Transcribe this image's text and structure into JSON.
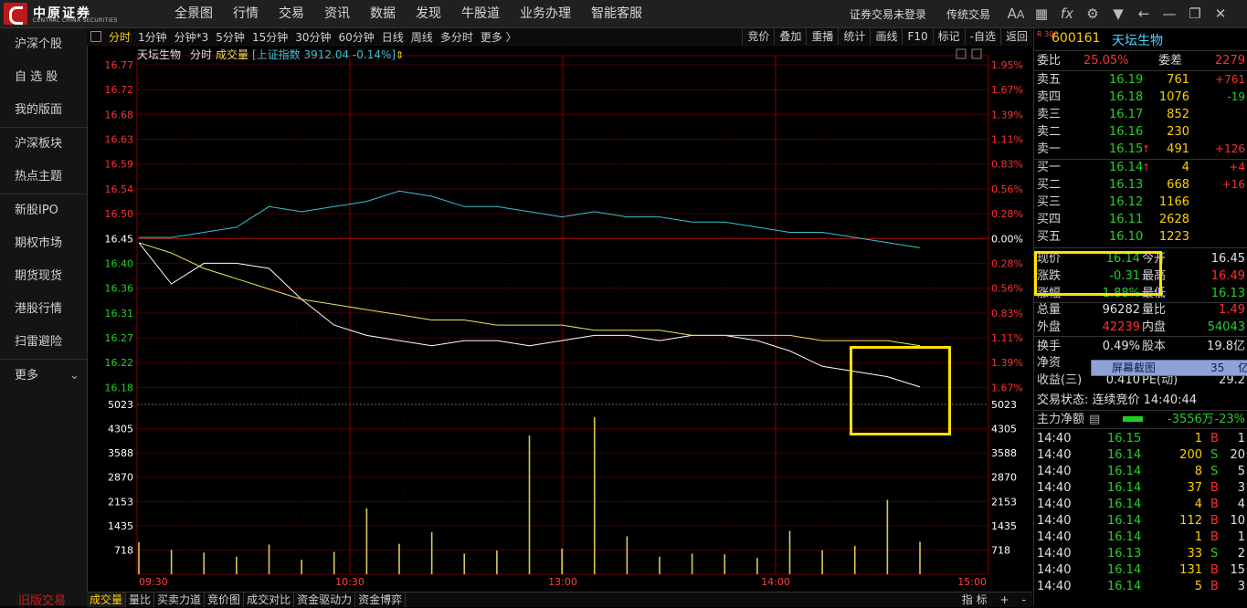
{
  "topbar": {
    "logo_cn": "中原证券",
    "logo_en": "CENTRAL CHINA SECURITIES",
    "menu": [
      "全景图",
      "行情",
      "交易",
      "资讯",
      "数据",
      "发现",
      "牛股道",
      "业务办理",
      "智能客服"
    ],
    "login": "证券交易未登录",
    "traditional": "传统交易",
    "icons": [
      "font-size-icon",
      "grid-icon",
      "fx-icon",
      "gear-icon",
      "shirt-icon",
      "back-arrow-icon",
      "minimize-icon",
      "restore-icon",
      "close-icon"
    ]
  },
  "sidebar": {
    "items": [
      "沪深个股",
      "自 选 股",
      "我的版面",
      "沪深板块",
      "热点主题",
      "新股IPO",
      "期权市场",
      "期货现货",
      "港股行情",
      "扫雷避险",
      "更多"
    ],
    "bottom_text": "旧版交易"
  },
  "toolbar": {
    "periods": [
      "分时",
      "1分钟",
      "分钟*3",
      "5分钟",
      "15分钟",
      "30分钟",
      "60分钟",
      "日线",
      "周线",
      "多分时",
      "更多 〉"
    ],
    "right_tools": [
      "竞价",
      "叠加",
      "重播",
      "统计",
      "画线",
      "F10",
      "标记",
      "-自选",
      "返回"
    ]
  },
  "chart_header": {
    "name": "天坛生物",
    "mode": "分时",
    "vol_label": "成交量",
    "index_text": "[上证指数 3912.04 -0.14%]",
    "arrow_icon": "up-down-arrow-icon"
  },
  "chart_data": {
    "type": "line",
    "time_ticks": [
      "09:30",
      "10:30",
      "13:00",
      "14:00",
      "15:00"
    ],
    "price_ticks": [
      "16.77",
      "16.72",
      "16.68",
      "16.63",
      "16.59",
      "16.54",
      "16.50",
      "16.45",
      "16.40",
      "16.36",
      "16.31",
      "16.27",
      "16.22",
      "16.18"
    ],
    "pct_ticks": [
      "1.95%",
      "1.67%",
      "1.39%",
      "1.11%",
      "0.83%",
      "0.56%",
      "0.28%",
      "0.00%",
      "0.28%",
      "0.56%",
      "0.83%",
      "1.11%",
      "1.39%",
      "1.67%"
    ],
    "prev_close": 16.45,
    "ylim": [
      16.135,
      16.785
    ],
    "vol_ticks": [
      "5023",
      "4305",
      "3588",
      "2870",
      "2153",
      "1435",
      "718"
    ],
    "vol_max": 5023,
    "series": [
      {
        "name": "天坛生物",
        "role": "price",
        "color": "#ffffff",
        "values": [
          16.44,
          16.36,
          16.4,
          16.4,
          16.39,
          16.33,
          16.28,
          16.26,
          16.25,
          16.24,
          16.25,
          16.25,
          16.24,
          16.25,
          16.26,
          16.26,
          16.25,
          16.26,
          16.26,
          16.25,
          16.23,
          16.2,
          16.19,
          16.18,
          16.16
        ]
      },
      {
        "name": "均价",
        "role": "avg",
        "color": "#f0e060",
        "values": [
          16.44,
          16.42,
          16.39,
          16.37,
          16.35,
          16.33,
          16.32,
          16.31,
          16.3,
          16.29,
          16.29,
          16.28,
          16.28,
          16.28,
          16.27,
          16.27,
          16.27,
          16.26,
          16.26,
          16.26,
          16.26,
          16.25,
          16.25,
          16.25,
          16.24
        ]
      },
      {
        "name": "上证指数",
        "role": "index",
        "color": "#3ac0d0",
        "values": [
          16.45,
          16.45,
          16.46,
          16.47,
          16.51,
          16.5,
          16.51,
          16.52,
          16.54,
          16.53,
          16.51,
          16.51,
          16.5,
          16.49,
          16.5,
          16.49,
          16.49,
          16.48,
          16.48,
          16.47,
          16.46,
          16.46,
          16.45,
          16.44,
          16.43
        ]
      }
    ],
    "volume": [
      950,
      720,
      640,
      520,
      880,
      430,
      660,
      1950,
      900,
      1240,
      610,
      700,
      4100,
      760,
      4650,
      1120,
      520,
      610,
      590,
      480,
      1280,
      710,
      840,
      2200,
      960
    ],
    "colors": {
      "up": "#ff3030",
      "down": "#24d024",
      "grid": "#5a0000",
      "vol_bar": "#d8c85a"
    }
  },
  "bottombar": {
    "tabs": [
      "成交量",
      "量比",
      "买卖力道",
      "竞价图",
      "成交对比",
      "资金驱动力",
      "资金博弈"
    ],
    "right": [
      "指 标",
      "+",
      "-"
    ]
  },
  "quote": {
    "badge": "R 300",
    "code": "600161",
    "name": "天坛生物",
    "weibi_label": "委比",
    "weibi": "25.05%",
    "weicha_label": "委差",
    "weicha": "2279",
    "asks": [
      {
        "label": "卖五",
        "price": "16.19",
        "vol": "761",
        "chg": "+761"
      },
      {
        "label": "卖四",
        "price": "16.18",
        "vol": "1076",
        "chg": "-19"
      },
      {
        "label": "卖三",
        "price": "16.17",
        "vol": "852",
        "chg": ""
      },
      {
        "label": "卖二",
        "price": "16.16",
        "vol": "230",
        "chg": ""
      },
      {
        "label": "卖一",
        "price": "16.15",
        "vol": "491",
        "chg": "+126",
        "arrow": "↑"
      }
    ],
    "bids": [
      {
        "label": "买一",
        "price": "16.14",
        "vol": "4",
        "chg": "+4",
        "arrow": "↑"
      },
      {
        "label": "买二",
        "price": "16.13",
        "vol": "668",
        "chg": "+16"
      },
      {
        "label": "买三",
        "price": "16.12",
        "vol": "1166",
        "chg": ""
      },
      {
        "label": "买四",
        "price": "16.11",
        "vol": "2628",
        "chg": ""
      },
      {
        "label": "买五",
        "price": "16.10",
        "vol": "1223",
        "chg": ""
      }
    ],
    "stats": [
      {
        "l1": "现价",
        "v1": "16.14",
        "c1": "green",
        "l2": "今开",
        "v2": "16.45",
        "c2": "white"
      },
      {
        "l1": "涨跌",
        "v1": "-0.31",
        "c1": "green",
        "l2": "最高",
        "v2": "16.49",
        "c2": "red"
      },
      {
        "l1": "涨幅",
        "v1": "-1.88%",
        "c1": "green",
        "l2": "最低",
        "v2": "16.13",
        "c2": "green"
      },
      {
        "l1": "总量",
        "v1": "96282",
        "c1": "white",
        "l2": "量比",
        "v2": "1.49",
        "c2": "red"
      },
      {
        "l1": "外盘",
        "v1": "42239",
        "c1": "red",
        "l2": "内盘",
        "v2": "54043",
        "c2": "green"
      },
      {
        "l1": "换手",
        "v1": "0.49%",
        "c1": "white",
        "l2": "股本",
        "v2": "19.8亿",
        "c2": "white"
      },
      {
        "l1": "净资",
        "v1": "",
        "c1": "white",
        "l2": "",
        "v2": "",
        "c2": "white"
      },
      {
        "l1": "收益(三)",
        "v1": "0.410",
        "c1": "white",
        "l2": "PE(动)",
        "v2": "29.2",
        "c2": "white"
      }
    ],
    "popup": "屏幕截图",
    "popup_num": "35",
    "popup_right": "亿",
    "trade_status": "交易状态: 连续竞价 14:40:44",
    "main_inflow_label": "主力净额",
    "main_inflow": "-3556万",
    "main_inflow_pct": "-23%",
    "ticks": [
      {
        "t": "14:40",
        "p": "16.15",
        "v": "1",
        "d": "B",
        "n": "1"
      },
      {
        "t": "14:40",
        "p": "16.14",
        "v": "200",
        "d": "S",
        "n": "20"
      },
      {
        "t": "14:40",
        "p": "16.14",
        "v": "8",
        "d": "S",
        "n": "5"
      },
      {
        "t": "14:40",
        "p": "16.14",
        "v": "37",
        "d": "B",
        "n": "3"
      },
      {
        "t": "14:40",
        "p": "16.14",
        "v": "4",
        "d": "B",
        "n": "4"
      },
      {
        "t": "14:40",
        "p": "16.14",
        "v": "112",
        "d": "B",
        "n": "10"
      },
      {
        "t": "14:40",
        "p": "16.14",
        "v": "1",
        "d": "B",
        "n": "1"
      },
      {
        "t": "14:40",
        "p": "16.13",
        "v": "33",
        "d": "S",
        "n": "2"
      },
      {
        "t": "14:40",
        "p": "16.14",
        "v": "131",
        "d": "B",
        "n": "15"
      },
      {
        "t": "14:40",
        "p": "16.14",
        "v": "5",
        "d": "B",
        "n": "3"
      }
    ]
  }
}
